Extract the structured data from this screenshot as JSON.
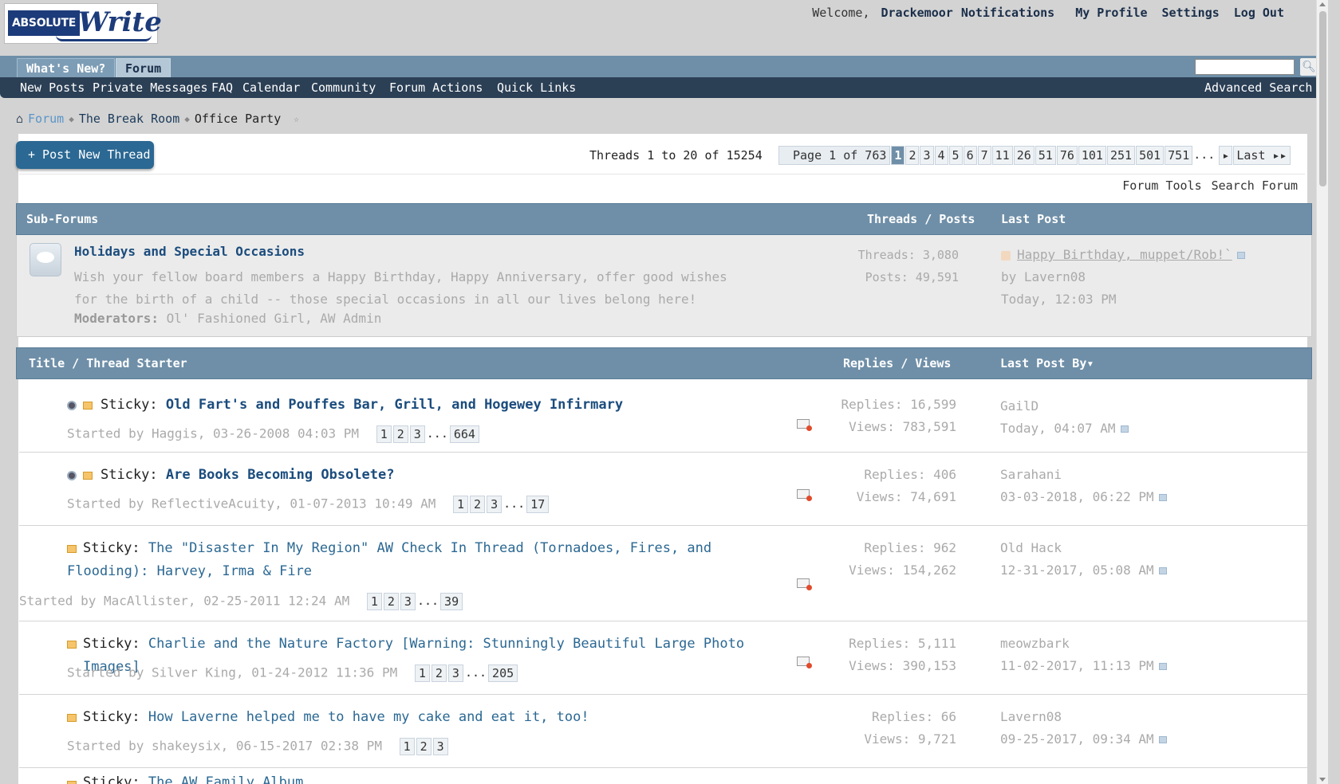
{
  "logo": {
    "part1": "ABSOLUTE",
    "part2": "Write"
  },
  "top": {
    "welcome": "Welcome,",
    "user": "Drackemoor",
    "notifications": "Notifications",
    "profile": "My Profile",
    "settings": "Settings",
    "logout": "Log Out"
  },
  "tabs": {
    "whats_new": "What's New?",
    "forum": "Forum"
  },
  "subnav": {
    "new_posts": "New Posts",
    "pm": "Private Messages",
    "faq": "FAQ",
    "calendar": "Calendar",
    "community": "Community",
    "forum_actions": "Forum Actions",
    "quick_links": "Quick Links",
    "advanced_search": "Advanced Search"
  },
  "breadcrumb": {
    "forum": "Forum",
    "break_room": "The Break Room",
    "office_party": "Office Party"
  },
  "actions": {
    "post_new_thread": "+ Post New Thread",
    "thread_count": "Threads 1 to 20 of 15254",
    "forum_tools": "Forum Tools",
    "search_forum": "Search Forum"
  },
  "pager": {
    "info": "Page 1 of 763",
    "current": "1",
    "pages": [
      "2",
      "3",
      "4",
      "5",
      "6",
      "7",
      "11",
      "26",
      "51",
      "76",
      "101",
      "251",
      "501",
      "751"
    ],
    "dots": "...",
    "next_icon": "▸",
    "last": "Last ▸▸"
  },
  "subforums": {
    "header_title": "Sub-Forums",
    "header_threads": "Threads / Posts",
    "header_last": "Last Post",
    "item": {
      "title": "Holidays and Special Occasions",
      "desc": "Wish your fellow board members a Happy Birthday, Happy Anniversary, offer good wishes for the birth of a child -- those special occasions in all our lives belong here!",
      "mods_label": "Moderators:",
      "mods": "Ol' Fashioned Girl, AW Admin",
      "threads": "Threads: 3,080",
      "posts": "Posts: 49,591",
      "last_title": "Happy Birthday, muppet/Rob!`",
      "last_by": "by Lavern08",
      "last_time": "Today, 12:03 PM"
    }
  },
  "threadlist": {
    "header_title": "Title / Thread Starter",
    "header_replies": "Replies / Views",
    "header_last": "Last Post By▾"
  },
  "threads": [
    {
      "prefix": "Sticky:",
      "title": "Old Fart's and Pouffes Bar, Grill, and Hogewey Infirmary",
      "started": "Started by Haggis, 03-26-2008 04:03 PM",
      "pages": [
        "1",
        "2",
        "3"
      ],
      "dots": "...",
      "lastpage": "664",
      "replies": "Replies: 16,599",
      "views": "Views: 783,591",
      "lastuser": "GailD",
      "lasttime": "Today, 04:07 AM"
    },
    {
      "prefix": "Sticky:",
      "title": "Are Books Becoming Obsolete?",
      "started": "Started by ReflectiveAcuity, 01-07-2013 10:49 AM",
      "pages": [
        "1",
        "2",
        "3"
      ],
      "dots": "...",
      "lastpage": "17",
      "replies": "Replies: 406",
      "views": "Views: 74,691",
      "lastuser": "Sarahani",
      "lasttime": "03-03-2018, 06:22 PM"
    },
    {
      "prefix": "Sticky:",
      "title": "The \"Disaster In My Region\" AW Check In Thread (Tornadoes, Fires, and Flooding): Harvey, Irma & Fire",
      "started": "Started by MacAllister, 02-25-2011 12:24 AM",
      "pages": [
        "1",
        "2",
        "3"
      ],
      "dots": "...",
      "lastpage": "39",
      "replies": "Replies: 962",
      "views": "Views: 154,262",
      "lastuser": "Old Hack",
      "lasttime": "12-31-2017, 05:08 AM"
    },
    {
      "prefix": "Sticky:",
      "title": "Charlie and the Nature Factory [Warning: Stunningly Beautiful Large Photo Images]",
      "started": "Started by Silver King, 01-24-2012 11:36 PM",
      "pages": [
        "1",
        "2",
        "3"
      ],
      "dots": "...",
      "lastpage": "205",
      "replies": "Replies: 5,111",
      "views": "Views: 390,153",
      "lastuser": "meowzbark",
      "lasttime": "11-02-2017, 11:13 PM"
    },
    {
      "prefix": "Sticky:",
      "title": "How Laverne helped me to have my cake and eat it, too!",
      "started": "Started by shakeysix, 06-15-2017 02:38 PM",
      "pages": [
        "1",
        "2",
        "3"
      ],
      "dots": "",
      "lastpage": "",
      "replies": "Replies: 66",
      "views": "Views: 9,721",
      "lastuser": "Lavern08",
      "lasttime": "09-25-2017, 09:34 AM"
    },
    {
      "prefix": "Sticky:",
      "title": "The AW Family Album"
    }
  ]
}
